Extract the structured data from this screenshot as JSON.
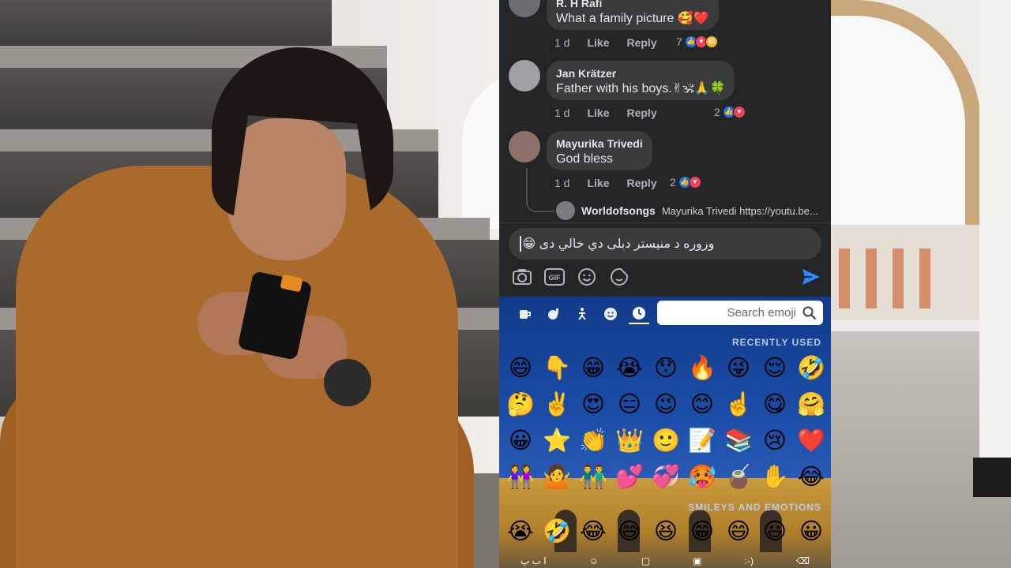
{
  "comments": [
    {
      "name": "R. H Rafi",
      "text": "What a family picture 🥰❤️",
      "time": "1 d",
      "like": "Like",
      "reply": "Reply",
      "reaction_count": "7"
    },
    {
      "name": "Jan Krätzer",
      "text": "Father with his boys.✌🕉🙏🍀",
      "time": "1 d",
      "like": "Like",
      "reply": "Reply",
      "reaction_count": "2"
    },
    {
      "name": "Mayurika Trivedi",
      "text": "God bless",
      "time": "1 d",
      "like": "Like",
      "reply": "Reply",
      "reaction_count": "2"
    }
  ],
  "reply_preview": {
    "name": "Worldofsongs",
    "text": "Mayurika Trivedi https://youtu.be..."
  },
  "composer": {
    "text": "وروره د منيستر دبلى دي خالي دى 😁"
  },
  "emoji_keyboard": {
    "search_placeholder": "Search emoji",
    "recent_label": "RECENTLY USED",
    "smileys_label": "SMILEYS AND EMOTIONS",
    "recent": [
      "😄",
      "👇",
      "😁",
      "😭",
      "😯",
      "🔥",
      "😜",
      "😌",
      "🤣",
      "🤔",
      "✌️",
      "😍",
      "😑",
      "😉",
      "😊",
      "☝️",
      "😋",
      "🤗",
      "😀",
      "⭐",
      "👏",
      "👑",
      "🙂",
      "📝",
      "📚",
      "😢",
      "❤️",
      "👭",
      "🤷",
      "👬",
      "💕",
      "💞",
      "🥵",
      "🧉",
      "✋",
      "😂"
    ],
    "smileys": [
      "😭",
      "🤣",
      "😂",
      "😅",
      "😆",
      "😁",
      "😄",
      "😃",
      "😀"
    ],
    "bottom_label": "ا ب پ"
  },
  "colors": {
    "panel_bg": "#242526",
    "bubble_bg": "#3a3b3c",
    "send_blue": "#2d88ff",
    "like_blue": "#1877f2",
    "love_red": "#f33e58"
  }
}
